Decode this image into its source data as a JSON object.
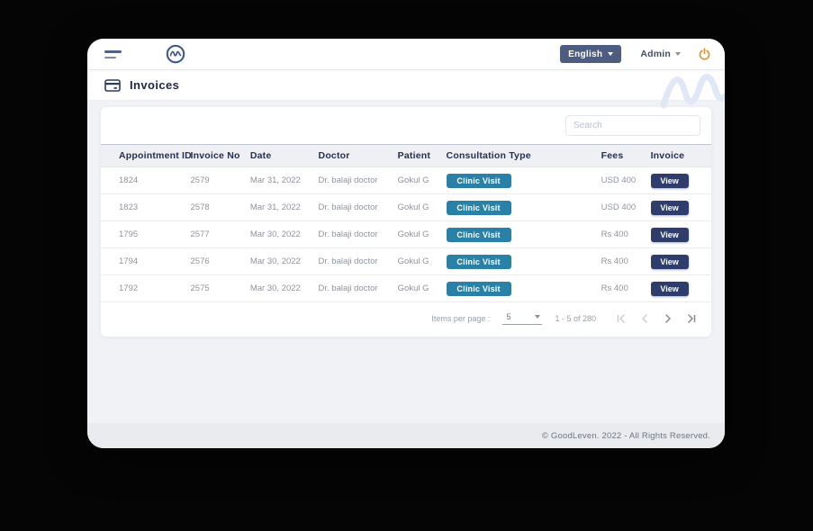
{
  "navbar": {
    "language_button": "English",
    "admin_label": "Admin"
  },
  "page": {
    "title": "Invoices"
  },
  "search": {
    "placeholder": "Search"
  },
  "table": {
    "headers": [
      "Appointment ID",
      "Invoice No",
      "Date",
      "Doctor",
      "Patient",
      "Consultation Type",
      "Fees",
      "Invoice"
    ],
    "rows": [
      {
        "appointment_id": "1824",
        "invoice_no": "2579",
        "date": "Mar 31, 2022",
        "doctor": "Dr. balaji doctor",
        "patient": "Gokul G",
        "consultation_type": "Clinic Visit",
        "fees": "USD 400",
        "invoice_action": "View"
      },
      {
        "appointment_id": "1823",
        "invoice_no": "2578",
        "date": "Mar 31, 2022",
        "doctor": "Dr. balaji doctor",
        "patient": "Gokul G",
        "consultation_type": "Clinic Visit",
        "fees": "USD 400",
        "invoice_action": "View"
      },
      {
        "appointment_id": "1795",
        "invoice_no": "2577",
        "date": "Mar 30, 2022",
        "doctor": "Dr. balaji doctor",
        "patient": "Gokul G",
        "consultation_type": "Clinic Visit",
        "fees": "Rs 400",
        "invoice_action": "View"
      },
      {
        "appointment_id": "1794",
        "invoice_no": "2576",
        "date": "Mar 30, 2022",
        "doctor": "Dr. balaji doctor",
        "patient": "Gokul G",
        "consultation_type": "Clinic Visit",
        "fees": "Rs 400",
        "invoice_action": "View"
      },
      {
        "appointment_id": "1792",
        "invoice_no": "2575",
        "date": "Mar 30, 2022",
        "doctor": "Dr. balaji doctor",
        "patient": "Gokul G",
        "consultation_type": "Clinic Visit",
        "fees": "Rs 400",
        "invoice_action": "View"
      }
    ]
  },
  "paginator": {
    "items_per_page_label": "Items per page :",
    "page_size": "5",
    "range_label": "1 - 5 of 280"
  },
  "footer": {
    "copyright": "© GoodLeven. 2022 - All Rights Reserved."
  },
  "colors": {
    "badge_teal": "#2a81a8",
    "button_navy": "#2e3d6b",
    "language_button_bg": "#4d5d82",
    "power_icon": "#df9434",
    "page_background": "#050505",
    "content_background": "#f0f2f6"
  },
  "icons": {
    "menu": "hamburger-menu",
    "logo": "goodleven-wave-logo",
    "title": "invoice-card-icon",
    "power": "power-icon",
    "pagination": [
      "first-page",
      "previous-page",
      "next-page",
      "last-page"
    ]
  }
}
